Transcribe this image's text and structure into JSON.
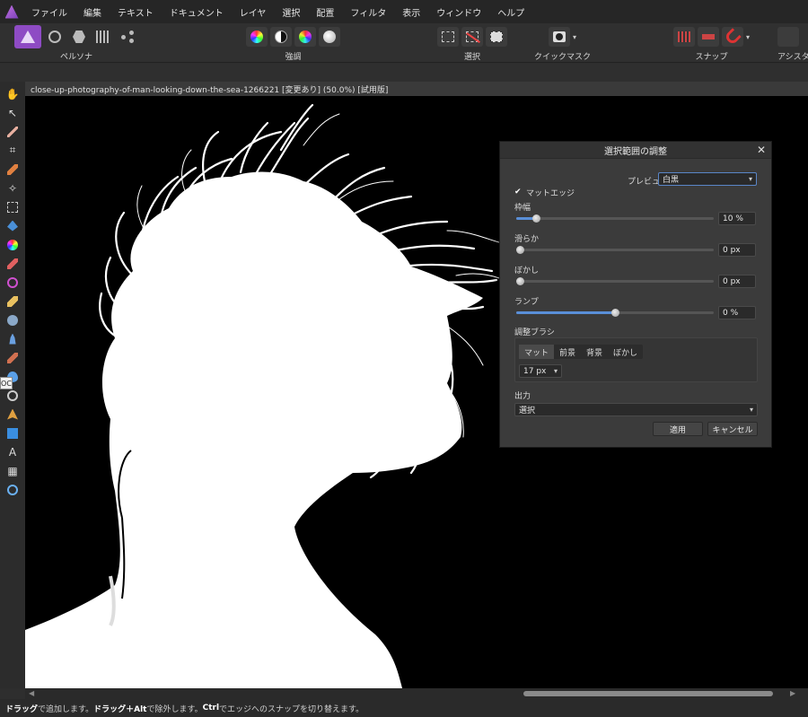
{
  "menu": {
    "items": [
      "ファイル",
      "編集",
      "テキスト",
      "ドキュメント",
      "レイヤ",
      "選択",
      "配置",
      "フィルタ",
      "表示",
      "ウィンドウ",
      "ヘルプ"
    ]
  },
  "toolbar": {
    "persona_label": "ペルソナ",
    "enhance_label": "強調",
    "select_label": "選択",
    "quickmask_label": "クイックマスク",
    "snap_label": "スナップ",
    "assistant_label": "アシスタン"
  },
  "document": {
    "tab_title": "close-up-photography-of-man-looking-down-the-sea-1266221 [変更あり] (50.0%) [試用版]"
  },
  "tooltip_badge": "OC",
  "dialog": {
    "title": "選択範囲の調整",
    "close": "✕",
    "preview_label": "プレビュー",
    "preview_value": "白黒",
    "matte_edge_label": "マットエッジ",
    "matte_edge_checked": true,
    "sliders": [
      {
        "label": "枠幅",
        "value_text": "10 %",
        "fraction": 0.1
      },
      {
        "label": "滑らか",
        "value_text": "0 px",
        "fraction": 0.0
      },
      {
        "label": "ぼかし",
        "value_text": "0 px",
        "fraction": 0.0
      },
      {
        "label": "ランプ",
        "value_text": "0 %",
        "fraction": 0.5
      }
    ],
    "brush_label": "調整ブラシ",
    "brush_modes": [
      "マット",
      "前景",
      "背景",
      "ぼかし"
    ],
    "brush_active": "マット",
    "brush_size": "17 px",
    "output_label": "出力",
    "output_value": "選択",
    "apply_label": "適用",
    "cancel_label": "キャンセル"
  },
  "status": {
    "drag": "ドラッグ",
    "text1": "で追加します。",
    "drag_alt": "ドラッグ＋Alt",
    "text2": "で除外します。",
    "ctrl": "Ctrl",
    "text3": "でエッジへのスナップを切り替えます。"
  },
  "colors": {
    "accent": "#5a8fd8",
    "persona": "#8e4bc4",
    "background": "#2e2e2e",
    "canvas": "#000000"
  }
}
